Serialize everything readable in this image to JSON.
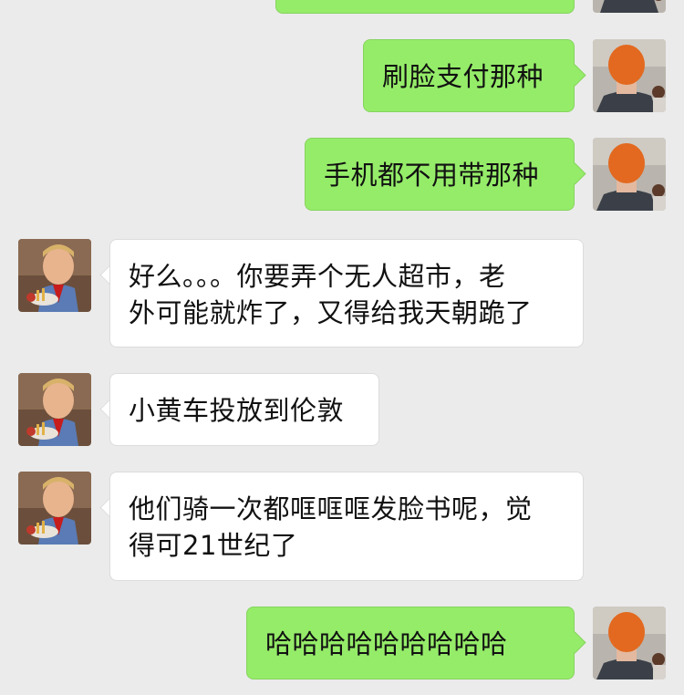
{
  "colors": {
    "background": "#ebebeb",
    "my_bubble": "#95ec69",
    "their_bubble": "#ffffff"
  },
  "messages": [
    {
      "sender": "me",
      "avatar": "orange-hair-person-avatar",
      "lines": [
        ""
      ]
    },
    {
      "sender": "me",
      "avatar": "orange-hair-person-avatar",
      "lines": [
        "刷脸支付那种"
      ]
    },
    {
      "sender": "me",
      "avatar": "orange-hair-person-avatar",
      "lines": [
        "手机都不用带那种"
      ]
    },
    {
      "sender": "them",
      "avatar": "boy-eating-avatar",
      "lines": [
        "好么。。。你要弄个无人超市，老",
        "外可能就炸了，又得给我天朝跪了"
      ]
    },
    {
      "sender": "them",
      "avatar": "boy-eating-avatar",
      "lines": [
        "小黄车投放到伦敦"
      ]
    },
    {
      "sender": "them",
      "avatar": "boy-eating-avatar",
      "lines": [
        "他们骑一次都哐哐哐发脸书呢，觉",
        "得可21世纪了"
      ]
    },
    {
      "sender": "me",
      "avatar": "orange-hair-person-avatar",
      "lines": [
        "哈哈哈哈哈哈哈哈哈"
      ]
    }
  ]
}
